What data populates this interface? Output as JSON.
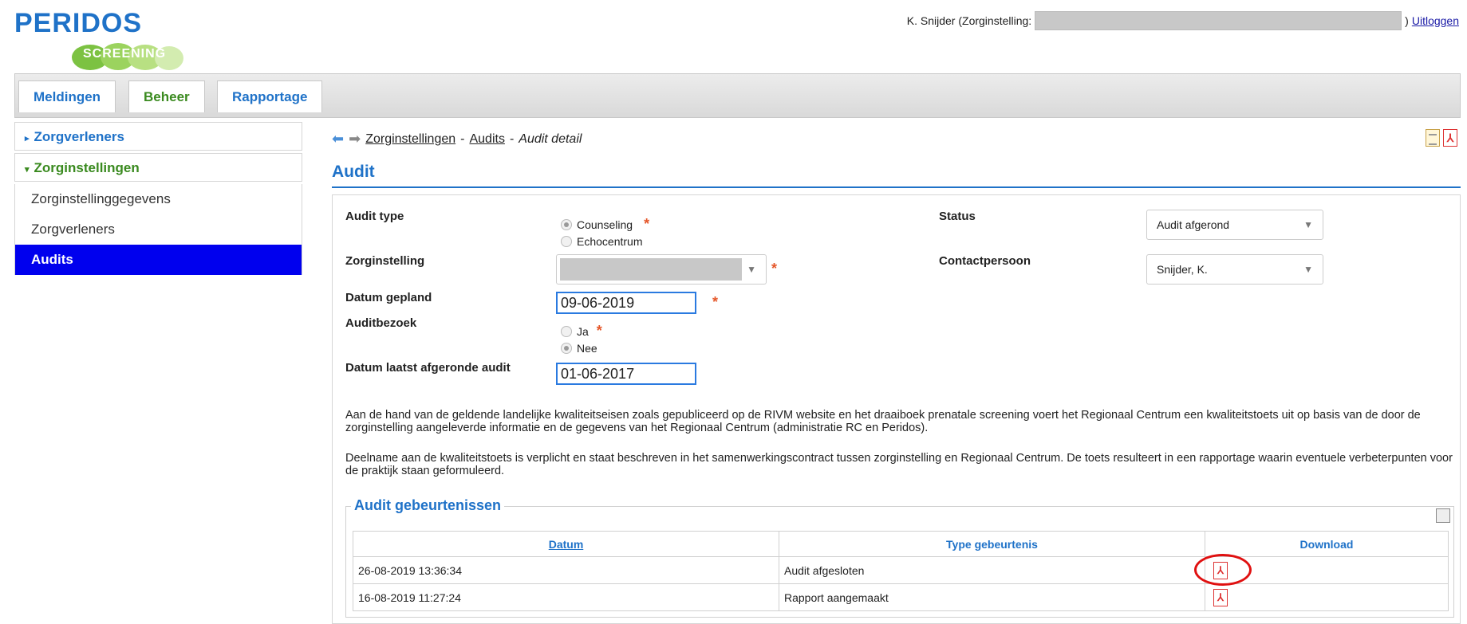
{
  "logo": {
    "title": "PERIDOS",
    "subtitle": "SCREENING"
  },
  "user": {
    "prefix": "K. Snijder (Zorginstelling:",
    "suffix": ")",
    "logout": "Uitloggen"
  },
  "tabs": [
    {
      "label": "Meldingen"
    },
    {
      "label": "Beheer"
    },
    {
      "label": "Rapportage"
    }
  ],
  "sidebar": {
    "group1": "Zorgverleners",
    "group2": "Zorginstellingen",
    "items": [
      {
        "label": "Zorginstellinggegevens"
      },
      {
        "label": "Zorgverleners"
      },
      {
        "label": "Audits"
      }
    ]
  },
  "breadcrumb": {
    "part1": "Zorginstellingen",
    "sep": "-",
    "part2": "Audits",
    "sep2": "-",
    "part3": "Audit detail"
  },
  "section": {
    "title": "Audit"
  },
  "form": {
    "audit_type_label": "Audit type",
    "audit_type_options": [
      "Counseling",
      "Echocentrum"
    ],
    "status_label": "Status",
    "status_value": "Audit afgerond",
    "zorginstelling_label": "Zorginstelling",
    "contactpersoon_label": "Contactpersoon",
    "contactpersoon_value": "Snijder, K.",
    "datum_gepland_label": "Datum gepland",
    "datum_gepland_value": "09-06-2019",
    "auditbezoek_label": "Auditbezoek",
    "auditbezoek_options": [
      "Ja",
      "Nee"
    ],
    "datum_laatst_label": "Datum laatst afgeronde audit",
    "datum_laatst_value": "01-06-2017",
    "required": "*"
  },
  "paragraphs": {
    "p1": "Aan de hand van de geldende landelijke kwaliteitseisen zoals gepubliceerd op de RIVM website en het draaiboek prenatale screening voert het Regionaal Centrum een kwaliteitstoets uit op basis van de door de zorginstelling aangeleverde informatie en de gegevens van het Regionaal Centrum (administratie RC en Peridos).",
    "p2": "Deelname aan de kwaliteitstoets is verplicht en staat beschreven in het samenwerkingscontract tussen zorginstelling en Regionaal Centrum. De toets resulteert in een rapportage waarin eventuele verbeterpunten voor de praktijk staan geformuleerd."
  },
  "events": {
    "title": "Audit gebeurtenissen",
    "headers": {
      "datum": "Datum",
      "type": "Type gebeurtenis",
      "download": "Download"
    },
    "rows": [
      {
        "datum": "26-08-2019 13:36:34",
        "type": "Audit afgesloten"
      },
      {
        "datum": "16-08-2019 11:27:24",
        "type": "Rapport aangemaakt"
      }
    ]
  }
}
